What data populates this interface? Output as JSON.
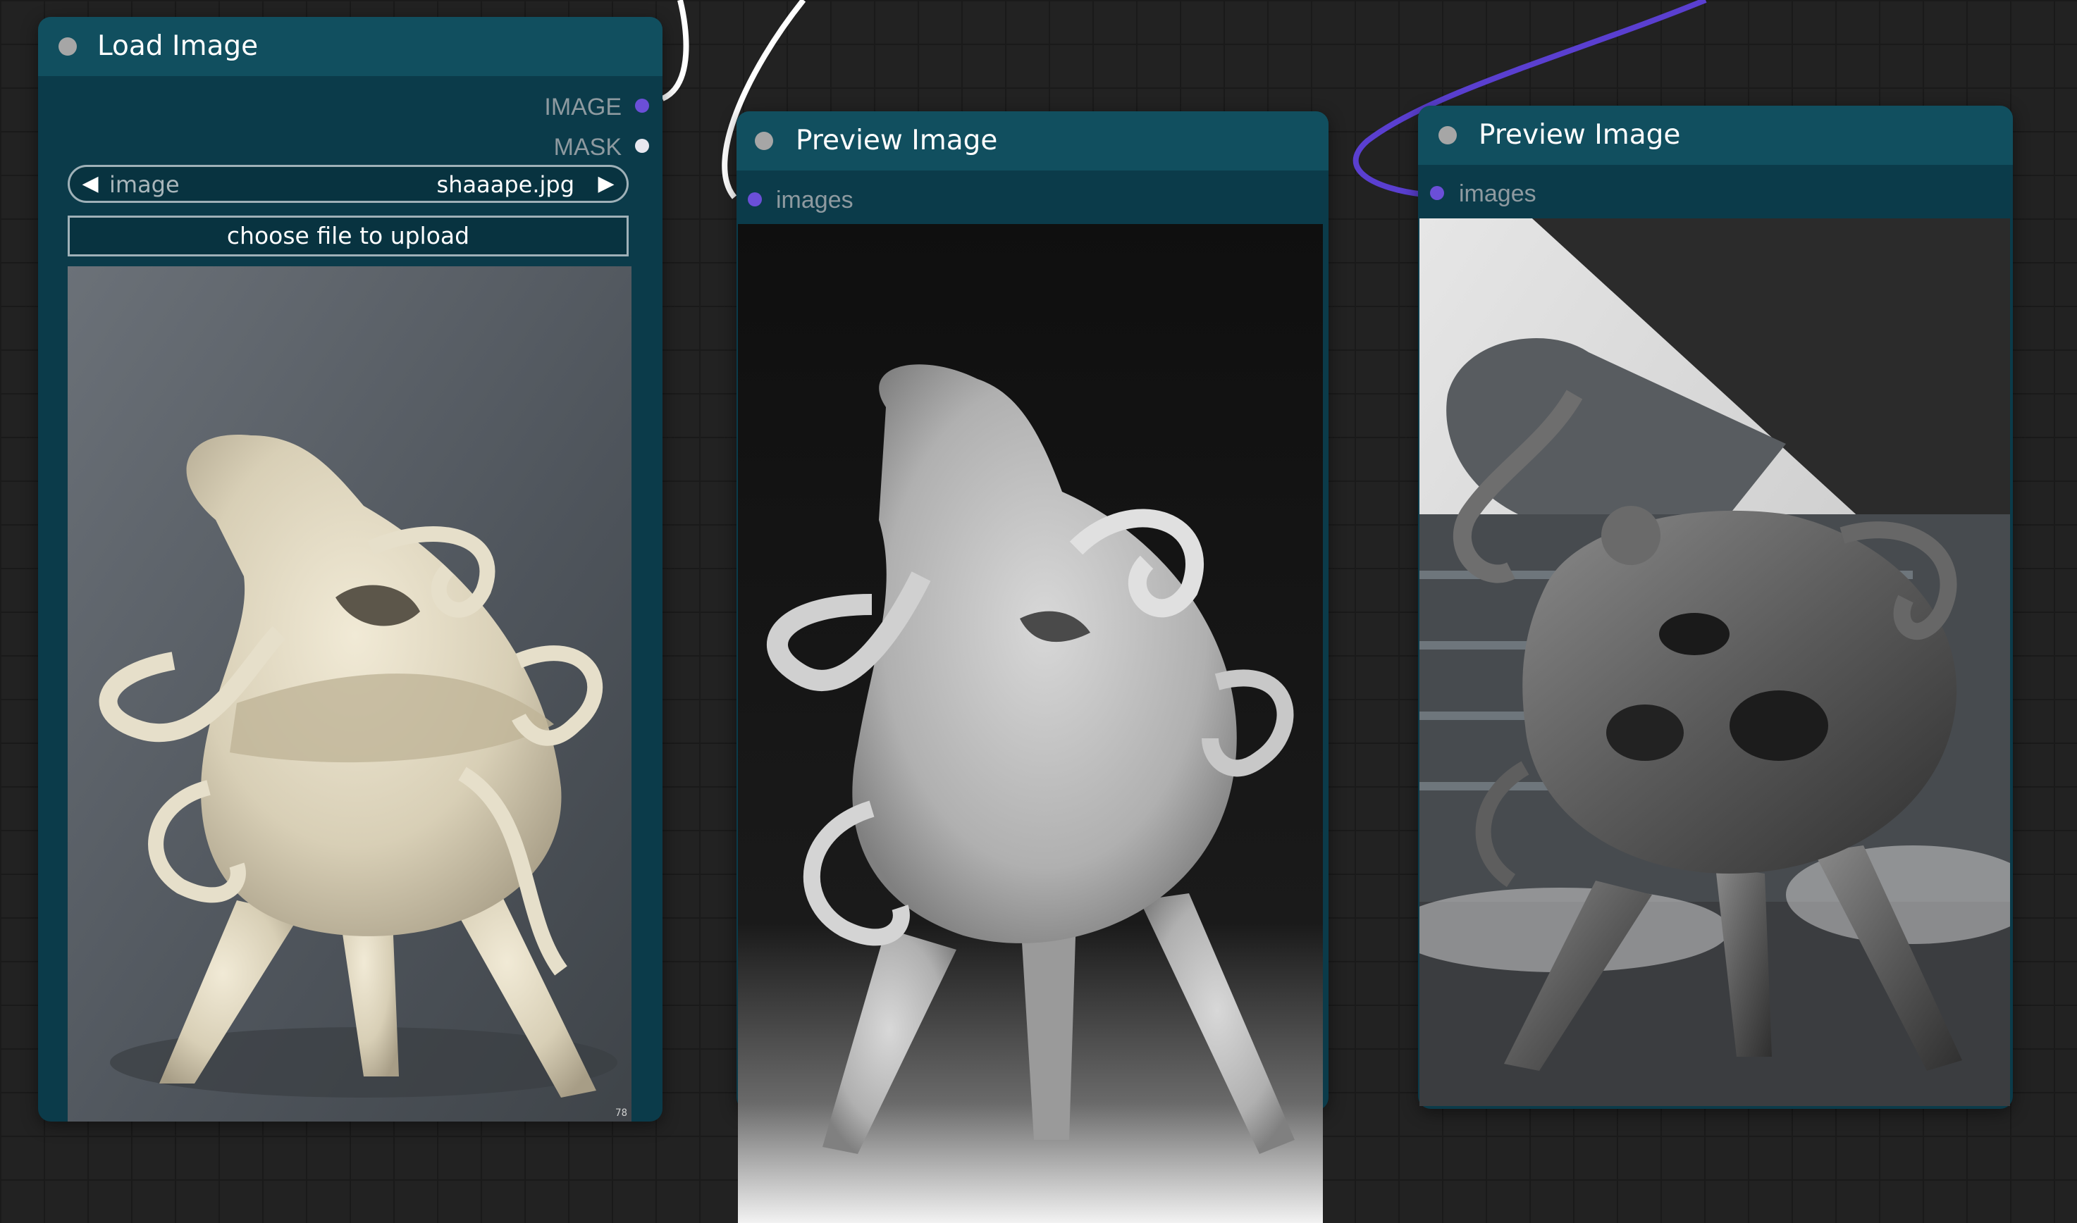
{
  "nodes": {
    "load_image": {
      "title": "Load Image",
      "outputs": [
        {
          "label": "IMAGE",
          "type_color": "#6b4fd8"
        },
        {
          "label": "MASK",
          "type_color": "#e8e8f0"
        }
      ],
      "image_widget": {
        "label": "image",
        "value": "shaaape.jpg",
        "left_arrow": "◀",
        "right_arrow": "▶"
      },
      "upload_button_label": "choose file to upload",
      "preview_description": "white ceramic tentacled sculpture",
      "corner_tag": "78"
    },
    "preview_depth": {
      "title": "Preview Image",
      "input_label": "images",
      "preview_description": "grayscale depth map of sculpture"
    },
    "preview_render": {
      "title": "Preview Image",
      "input_label": "images",
      "preview_description": "dark stone sculpture in front of building"
    }
  },
  "colors": {
    "canvas": "#222222",
    "node_body": "#0b3b4a",
    "node_header": "#114f5f",
    "link_white": "#ffffff",
    "link_purple": "#5a3fd0",
    "slot_image": "#6b4fd8"
  }
}
